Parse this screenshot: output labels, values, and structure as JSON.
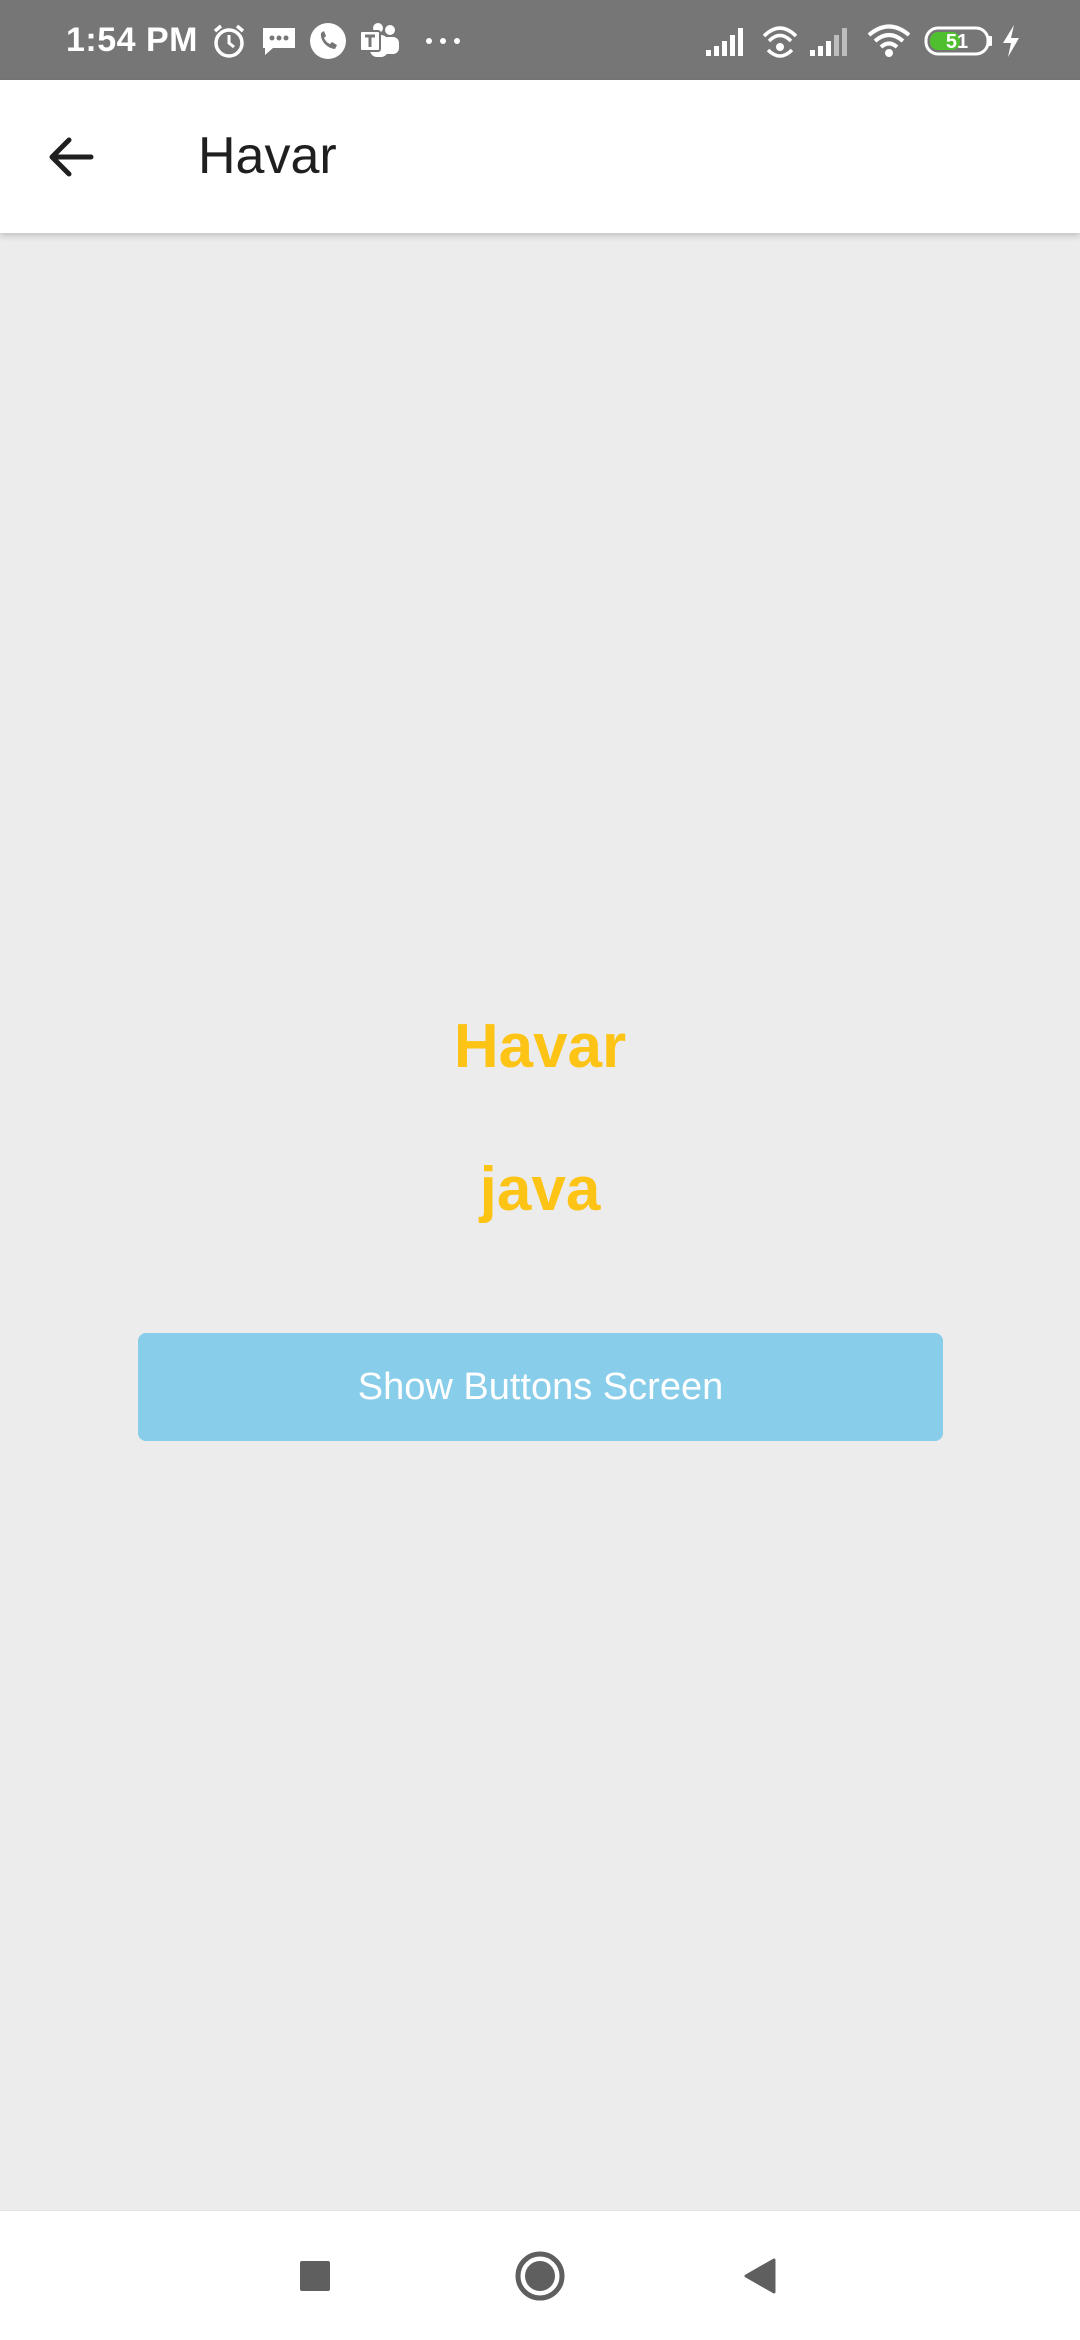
{
  "status_bar": {
    "time": "1:54 PM",
    "battery_level": "51",
    "icons": [
      "alarm-icon",
      "message-icon",
      "phone-icon",
      "teams-icon",
      "more-dots-icon",
      "signal-icon",
      "hotspot-icon",
      "signal-icon",
      "wifi-icon",
      "battery-icon",
      "charging-icon"
    ]
  },
  "app_bar": {
    "back_icon": "arrow-back-icon",
    "title": "Havar"
  },
  "content": {
    "headline_1": "Havar",
    "headline_2": "java",
    "button_label": "Show Buttons Screen"
  },
  "nav_bar": {
    "buttons": [
      "recents-square-icon",
      "home-circle-icon",
      "back-triangle-icon"
    ]
  },
  "colors": {
    "status_bar_bg": "#767676",
    "app_bar_bg": "#ffffff",
    "content_bg": "#ececec",
    "headline": "#fdc315",
    "button_bg": "#88cdea",
    "button_text": "#ffffff",
    "battery_fill": "#4fbf2f"
  }
}
